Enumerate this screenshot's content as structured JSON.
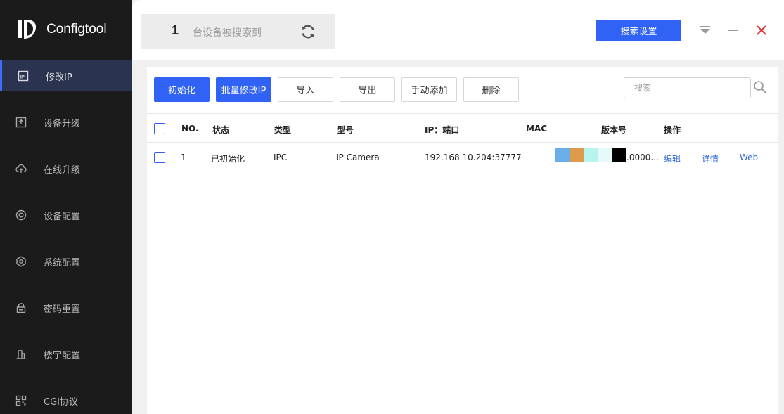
{
  "app": {
    "name": "Configtool"
  },
  "sidebar": {
    "items": [
      {
        "label": "修改IP",
        "icon": "ip-icon",
        "active": true
      },
      {
        "label": "设备升级",
        "icon": "upgrade-icon",
        "active": false
      },
      {
        "label": "在线升级",
        "icon": "cloud-upload-icon",
        "active": false
      },
      {
        "label": "设备配置",
        "icon": "device-config-icon",
        "active": false
      },
      {
        "label": "系统配置",
        "icon": "system-config-icon",
        "active": false
      },
      {
        "label": "密码重置",
        "icon": "password-reset-icon",
        "active": false
      },
      {
        "label": "楼宇配置",
        "icon": "building-config-icon",
        "active": false
      },
      {
        "label": "CGI协议",
        "icon": "cgi-protocol-icon",
        "active": false
      }
    ]
  },
  "topbar": {
    "device_count": "1",
    "device_count_text": "台设备被搜索到",
    "search_settings_label": "搜索设置"
  },
  "toolbar": {
    "initialize_label": "初始化",
    "batch_modify_ip_label": "批量修改IP",
    "import_label": "导入",
    "export_label": "导出",
    "manual_add_label": "手动添加",
    "delete_label": "删除",
    "search_placeholder": "搜索"
  },
  "table": {
    "columns": [
      "NO.",
      "状态",
      "类型",
      "型号",
      "IP：端口",
      "MAC",
      "版本号",
      "操作"
    ],
    "rows": [
      {
        "no": "1",
        "status": "已初始化",
        "type": "IPC",
        "model": "IP Camera",
        "ip_port": "192.168.10.204:37777",
        "version": ".0000...",
        "action_edit": "编辑",
        "action_details": "详情",
        "action_web": "Web"
      }
    ]
  },
  "colors": {
    "accent": "#2f62f5",
    "sidebar_bg": "#1b1b1b",
    "link": "#3169d8",
    "close": "#e0393e",
    "mac_redaction": [
      "#6aaee9",
      "#dd9a4a",
      "#b8f4ee",
      "#e6fbf9",
      "#000000"
    ]
  }
}
